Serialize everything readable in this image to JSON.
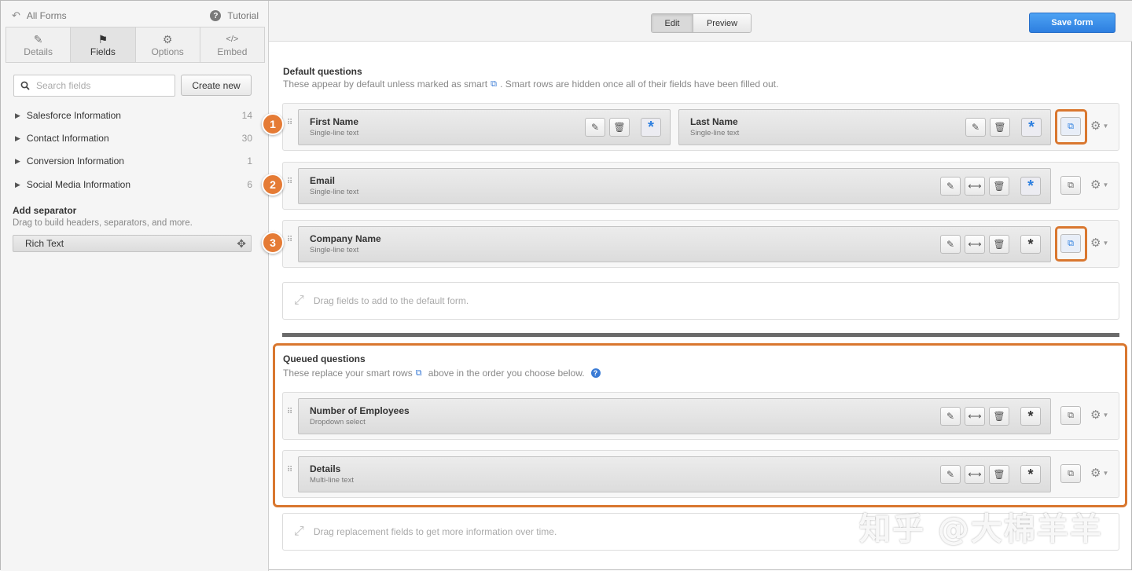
{
  "sidebar": {
    "back_label": "All Forms",
    "tutorial_label": "Tutorial",
    "tabs": [
      {
        "label": "Details",
        "icon": "pencil-icon"
      },
      {
        "label": "Fields",
        "icon": "flag-icon"
      },
      {
        "label": "Options",
        "icon": "gear-icon"
      },
      {
        "label": "Embed",
        "icon": "code-icon"
      }
    ],
    "active_tab": "Fields",
    "search_placeholder": "Search fields",
    "create_new_label": "Create new",
    "categories": [
      {
        "label": "Salesforce Information",
        "count": "14"
      },
      {
        "label": "Contact Information",
        "count": "30"
      },
      {
        "label": "Conversion Information",
        "count": "1"
      },
      {
        "label": "Social Media Information",
        "count": "6"
      }
    ],
    "separator_title": "Add separator",
    "separator_desc": "Drag to build headers, separators, and more.",
    "rich_text_label": "Rich Text"
  },
  "toolbar": {
    "edit_label": "Edit",
    "preview_label": "Preview",
    "save_label": "Save form"
  },
  "default_section": {
    "title": "Default questions",
    "desc_before": "These appear by default unless marked as smart",
    "desc_after": ". Smart rows are hidden once all of their fields have been filled out.",
    "rows": [
      {
        "badge": "1",
        "fields": [
          {
            "name": "First Name",
            "type": "Single-line text"
          },
          {
            "name": "Last Name",
            "type": "Single-line text"
          }
        ]
      },
      {
        "badge": "2",
        "fields": [
          {
            "name": "Email",
            "type": "Single-line text"
          }
        ]
      },
      {
        "badge": "3",
        "fields": [
          {
            "name": "Company Name",
            "type": "Single-line text"
          }
        ]
      }
    ],
    "dropzone_label": "Drag fields to add to the default form."
  },
  "queued_section": {
    "title": "Queued questions",
    "desc_before": "These replace your smart rows",
    "desc_after": "above in the order you choose below.",
    "rows": [
      {
        "name": "Number of Employees",
        "type": "Dropdown select"
      },
      {
        "name": "Details",
        "type": "Multi-line text"
      }
    ],
    "dropzone_label": "Drag replacement fields to get more information over time."
  },
  "watermark": "知乎 @大棉羊羊",
  "colors": {
    "accent": "#2d7fe0",
    "highlight": "#d9772f",
    "badge": "#e57b35"
  }
}
